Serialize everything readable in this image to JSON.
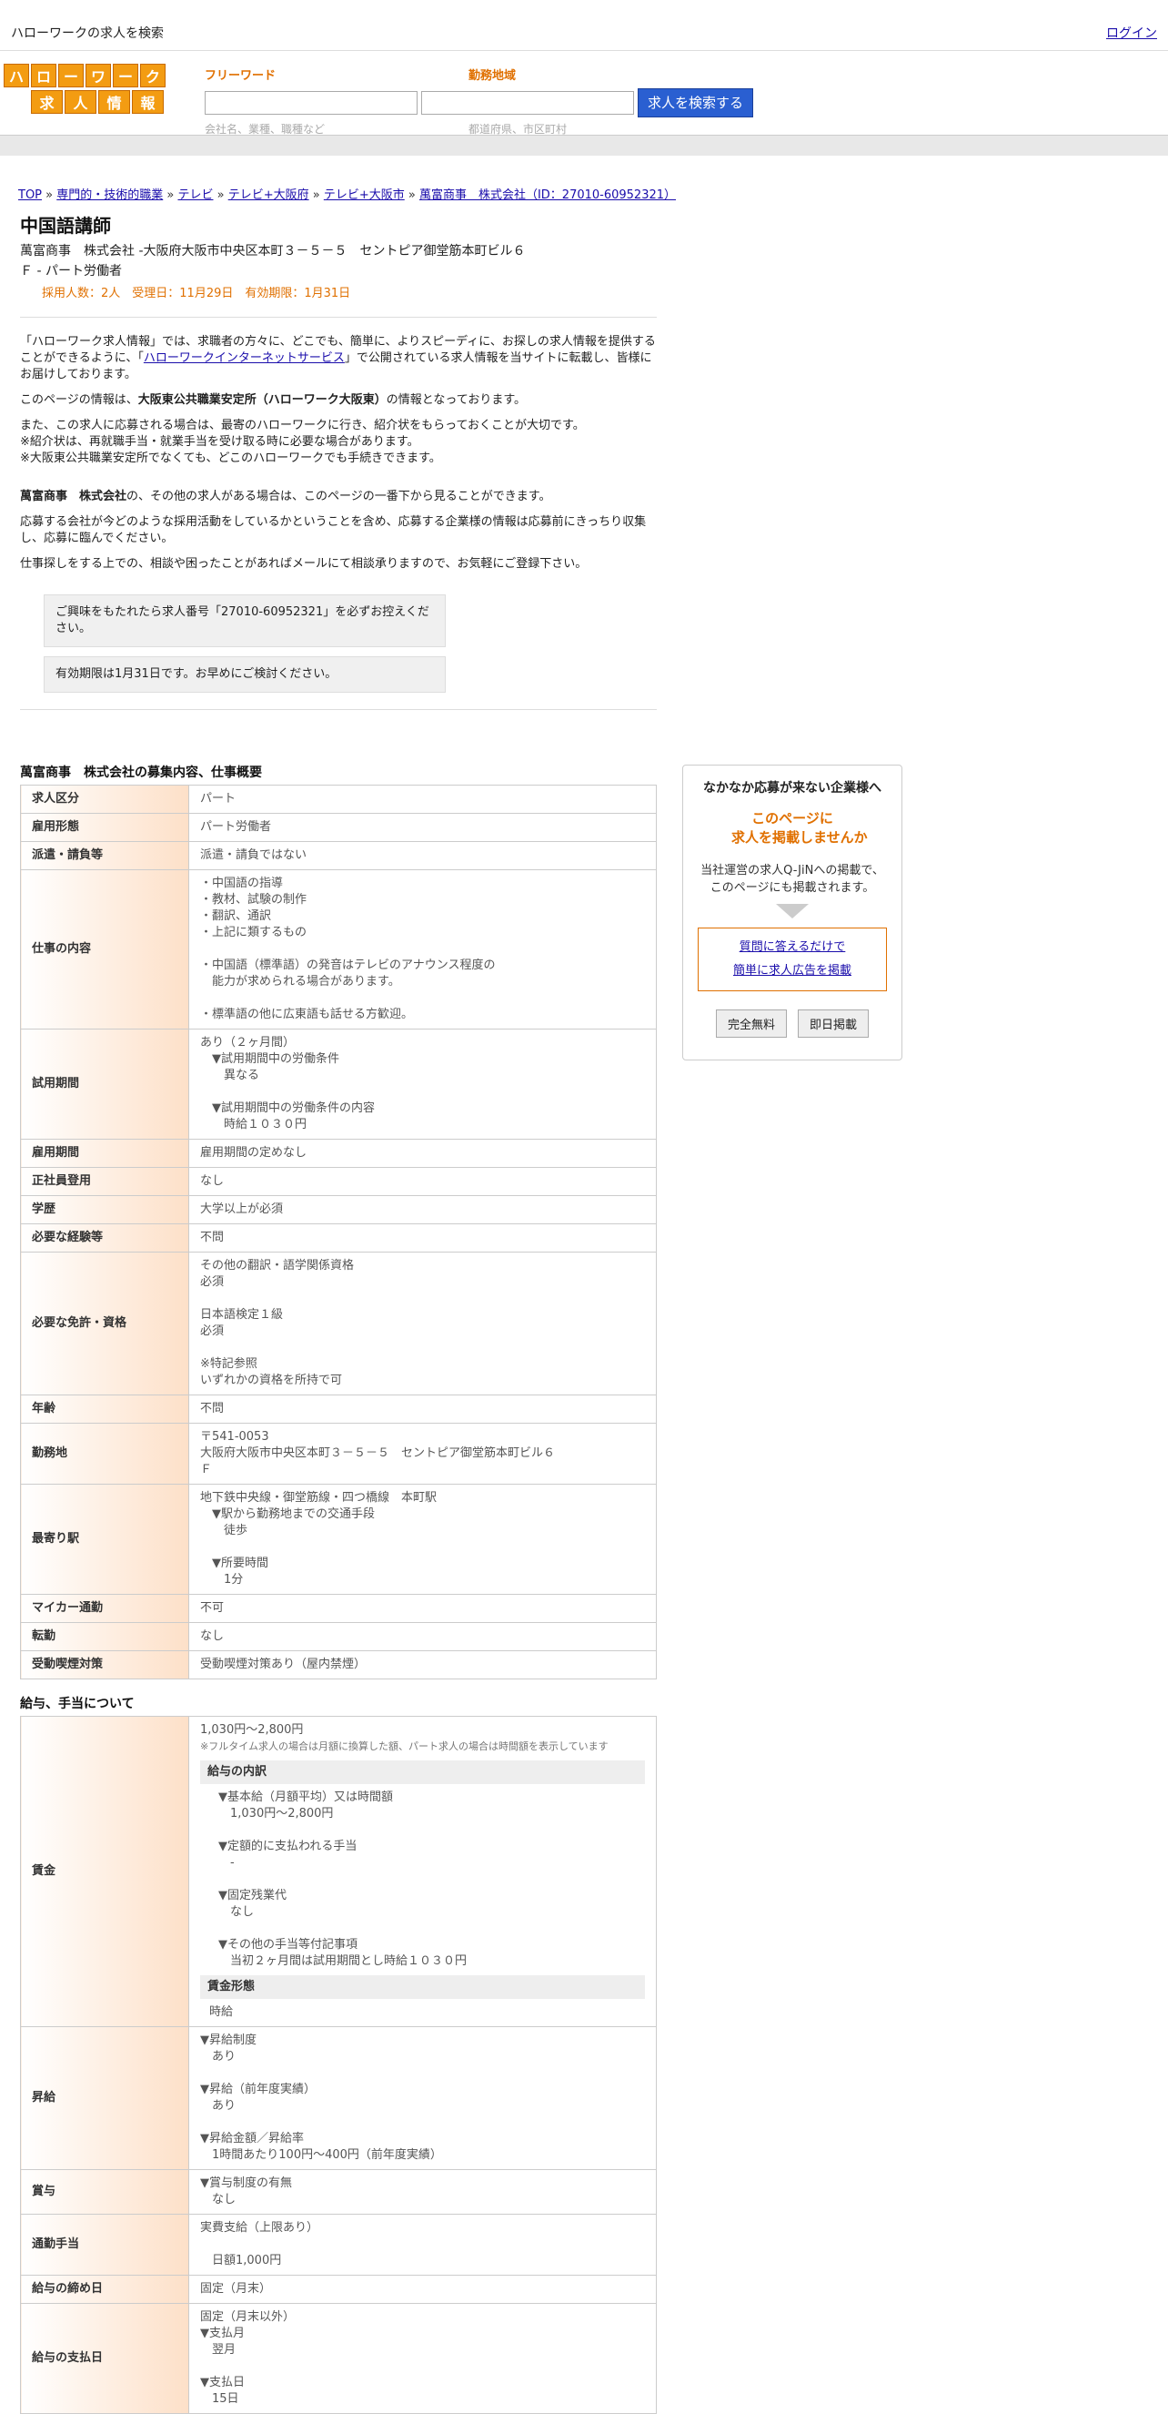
{
  "topbar": {
    "title": "ハローワークの求人を検索",
    "login": "ログイン"
  },
  "logo": {
    "row1": [
      "ハ",
      "ロ",
      "ー",
      "ワ",
      "ー",
      "ク"
    ],
    "row2": [
      "求",
      "人",
      "情",
      "報"
    ]
  },
  "search": {
    "label_keyword": "フリーワード",
    "label_area": "勤務地域",
    "button": "求人を検索する",
    "ph_keyword": "会社名、業種、職種など",
    "ph_area": "都道府県、市区町村"
  },
  "breadcrumb": [
    {
      "text": "TOP",
      "sep": " » "
    },
    {
      "text": "専門的・技術的職業",
      "sep": " » "
    },
    {
      "text": "テレビ",
      "sep": " » "
    },
    {
      "text": "テレビ+大阪府",
      "sep": " » "
    },
    {
      "text": "テレビ+大阪市",
      "sep": " » "
    },
    {
      "text": "萬富商事　株式会社（ID：27010-60952321）",
      "sep": ""
    }
  ],
  "job": {
    "title": "中国語講師",
    "company_line": "萬富商事　株式会社 -大阪府大阪市中央区本町３－５－５　セントピア御堂筋本町ビル６",
    "type_line": "Ｆ - パート労働者",
    "meta_line": "採用人数：2人　受理日：11月29日　有効期限：1月31日"
  },
  "intro": {
    "p1a": "「ハローワーク求人情報」では、求職者の方々に、どこでも、簡単に、よりスピーディに、お探しの求人情報を提供することができるように、「",
    "p1link": "ハローワークインターネットサービス",
    "p1b": "」で公開されている求人情報を当サイトに転載し、皆様にお届けしております。",
    "p2a": "このページの情報は、",
    "p2bold": "大阪東公共職業安定所（ハローワーク大阪東）",
    "p2b": "の情報となっております。",
    "p3": "また、この求人に応募される場合は、最寄のハローワークに行き、紹介状をもらっておくことが大切です。",
    "p3n1": "※紹介状は、再就職手当・就業手当を受け取る時に必要な場合があります。",
    "p3n2": "※大阪東公共職業安定所でなくても、どこのハローワークでも手続きできます。",
    "p4bold": "萬富商事　株式会社",
    "p4": "の、その他の求人がある場合は、このページの一番下から見ることができます。",
    "p5": "応募する会社が今どのような採用活動をしているかということを含め、応募する企業様の情報は応募前にきっちり収集し、応募に臨んでください。",
    "p6": "仕事探しをする上での、相談や困ったことがあればメールにて相談承りますので、お気軽にご登録下さい。",
    "note1": "ご興味をもたれたら求人番号「27010-60952321」を必ずお控えください。",
    "note2": "有効期限は1月31日です。お早めにご検討ください。"
  },
  "section1_title": "萬富商事　株式会社の募集内容、仕事概要",
  "table1": [
    {
      "k": "求人区分",
      "v": "パート"
    },
    {
      "k": "雇用形態",
      "v": "パート労働者"
    },
    {
      "k": "派遣・請負等",
      "v": "派遣・請負ではない"
    },
    {
      "k": "仕事の内容",
      "v": "・中国語の指導\n・教材、試験の制作\n・翻訳、通訳\n・上記に類するもの\n\n・中国語（標準語）の発音はテレビのアナウンス程度の\n　能力が求められる場合があります。\n\n・標準語の他に広東語も話せる方歓迎。"
    },
    {
      "k": "試用期間",
      "v": "あり（２ヶ月間）\n　▼試用期間中の労働条件\n　　異なる\n\n　▼試用期間中の労働条件の内容\n　　時給１０３０円"
    },
    {
      "k": "雇用期間",
      "v": "雇用期間の定めなし"
    },
    {
      "k": "正社員登用",
      "v": "なし"
    },
    {
      "k": "学歴",
      "v": "大学以上が必須"
    },
    {
      "k": "必要な経験等",
      "v": "不問"
    },
    {
      "k": "必要な免許・資格",
      "v": "その他の翻訳・語学関係資格\n必須\n\n日本語検定１級\n必須\n\n※特記参照\nいずれかの資格を所持で可"
    },
    {
      "k": "年齢",
      "v": "不問"
    },
    {
      "k": "勤務地",
      "v": "〒541-0053\n大阪府大阪市中央区本町３－５－５　セントピア御堂筋本町ビル６\nＦ"
    },
    {
      "k": "最寄り駅",
      "v": "地下鉄中央線・御堂筋線・四つ橋線　本町駅\n　▼駅から勤務地までの交通手段\n　　徒歩\n\n　▼所要時間\n　　1分"
    },
    {
      "k": "マイカー通勤",
      "v": "不可"
    },
    {
      "k": "転勤",
      "v": "なし"
    },
    {
      "k": "受動喫煙対策",
      "v": "受動喫煙対策あり（屋内禁煙）"
    }
  ],
  "section2_title": "給与、手当について",
  "wage": {
    "k": "賃金",
    "range": "1,030円〜2,800円",
    "small": "※フルタイム求人の場合は月額に換算した額、パート求人の場合は時間額を表示しています",
    "head1": "給与の内訳",
    "detail": "▼基本給（月額平均）又は時間額\n　1,030円〜2,800円\n\n▼定額的に支払われる手当\n　-\n\n▼固定残業代\n　なし\n\n▼その他の手当等付記事項\n　当初２ヶ月間は試用期間とし時給１０３０円",
    "head2": "賃金形態",
    "form": "時給"
  },
  "table2": [
    {
      "k": "昇給",
      "v": "▼昇給制度\n　あり\n\n▼昇給（前年度実績）\n　あり\n\n▼昇給金額／昇給率\n　1時間あたり100円〜400円（前年度実績）"
    },
    {
      "k": "賞与",
      "v": "▼賞与制度の有無\n　なし"
    },
    {
      "k": "通勤手当",
      "v": "実費支給（上限あり）\n\n　日額1,000円"
    },
    {
      "k": "給与の締め日",
      "v": "固定（月末）"
    },
    {
      "k": "給与の支払日",
      "v": "固定（月末以外）\n▼支払月\n　翌月\n\n▼支払日\n　15日"
    }
  ],
  "side": {
    "heading": "なかなか応募が来ない企業様へ",
    "orange1": "このページに",
    "orange2": "求人を掲載しませんか",
    "body1": "当社運営の求人Q-JiNへの掲載で、",
    "body2": "このページにも掲載されます。",
    "link1": "質問に答えるだけで",
    "link2": "簡単に求人広告を掲載",
    "btn1": "完全無料",
    "btn2": "即日掲載"
  }
}
